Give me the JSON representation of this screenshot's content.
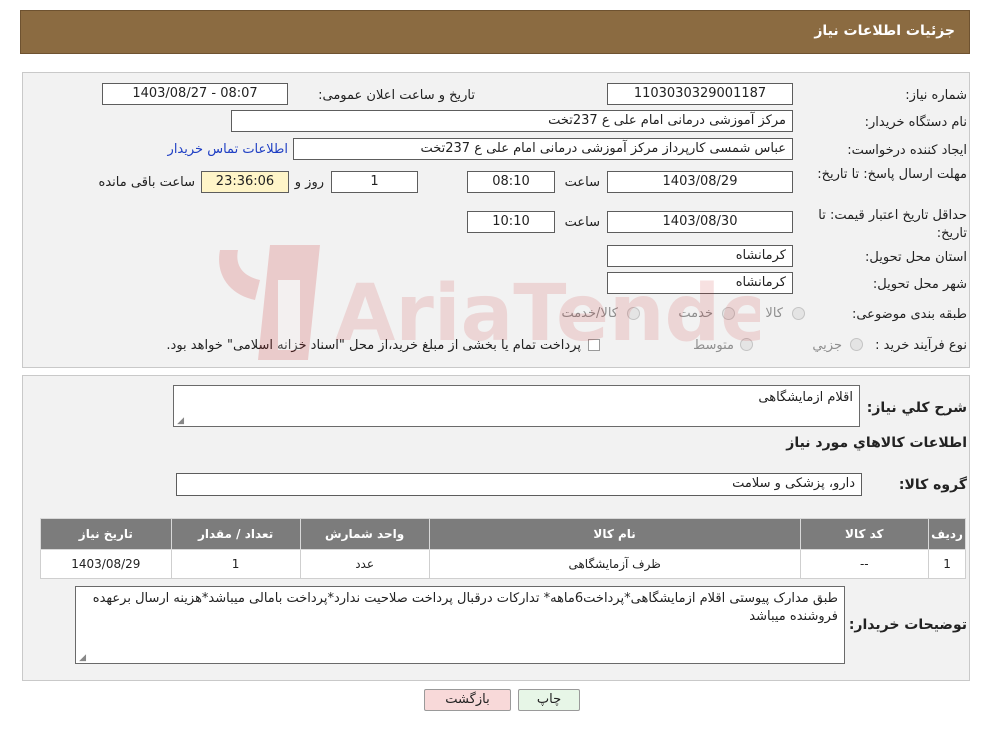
{
  "header": {
    "title": "جزئیات اطلاعات نیاز"
  },
  "form": {
    "need_number_label": "شماره نیاز:",
    "need_number": "1103030329001187",
    "announce_label": "تاریخ و ساعت اعلان عمومی:",
    "announce_value": "1403/08/27 - 08:07",
    "buyer_org_label": "نام دستگاه خریدار:",
    "buyer_org": "مرکز آموزشی درمانی امام علی ع 237تخت",
    "requester_label": "ایجاد کننده درخواست:",
    "requester": "عباس شمسی کارپرداز  مرکز آموزشی درمانی امام علی ع 237تخت",
    "buyer_contact_link": "اطلاعات تماس خریدار",
    "deadline_label": "مهلت ارسال پاسخ: تا تاریخ:",
    "deadline_date": "1403/08/29",
    "time_label": "ساعت",
    "deadline_time": "08:10",
    "days_value": "1",
    "days_label": "روز و",
    "remaining_time": "23:36:06",
    "remaining_label": "ساعت باقی مانده",
    "validity_label": "حداقل تاریخ اعتبار قیمت: تا تاریخ:",
    "validity_date": "1403/08/30",
    "validity_time": "10:10",
    "province_label": "استان محل تحویل:",
    "province": "کرمانشاه",
    "city_label": "شهر محل تحویل:",
    "city": "کرمانشاه",
    "category_label": "طبقه بندی موضوعی:",
    "category_options": [
      "کالا",
      "خدمت",
      "کالا/خدمت"
    ],
    "purchase_label": "نوع فرآیند خرید :",
    "purchase_options": [
      "جزیي",
      "متوسط"
    ],
    "purchase_note": "پرداخت تمام یا بخشی از مبلغ خرید،از محل \"اسناد خزانه اسلامی\" خواهد بود."
  },
  "details": {
    "summary_label": "شرح کلي نياز:",
    "summary_value": "اقلام ازمایشگاهی",
    "goods_info_title": "اطلاعات کالاهاي مورد نياز",
    "goods_group_label": "گروه کالا:",
    "goods_group_value": "دارو، پزشکی و سلامت",
    "table": {
      "headers": [
        "ردیف",
        "کد کالا",
        "نام کالا",
        "واحد شمارش",
        "تعداد / مقدار",
        "تاریخ نیاز"
      ],
      "rows": [
        [
          "1",
          "--",
          "ظرف آزمایشگاهی",
          "عدد",
          "1",
          "1403/08/29"
        ]
      ]
    },
    "buyer_notes_label": "توضیحات خریدار:",
    "buyer_notes": "طبق مدارک پیوستی اقلام ازمایشگاهی*پرداخت6ماهه* تدارکات درقبال پرداخت صلاحیت ندارد*پرداخت بامالی میباشد*هزینه ارسال برعهده فروشنده میباشد"
  },
  "buttons": {
    "print": "چاپ",
    "back": "بازگشت"
  },
  "colors": {
    "header_bg": "#8b6b41",
    "table_header_bg": "#7c7c7c",
    "back_button_bg": "#f8d9d9",
    "print_button_bg": "#e7f6e7",
    "link": "#1f3fc4"
  },
  "watermark": {
    "text": "AriaTender.neT"
  }
}
